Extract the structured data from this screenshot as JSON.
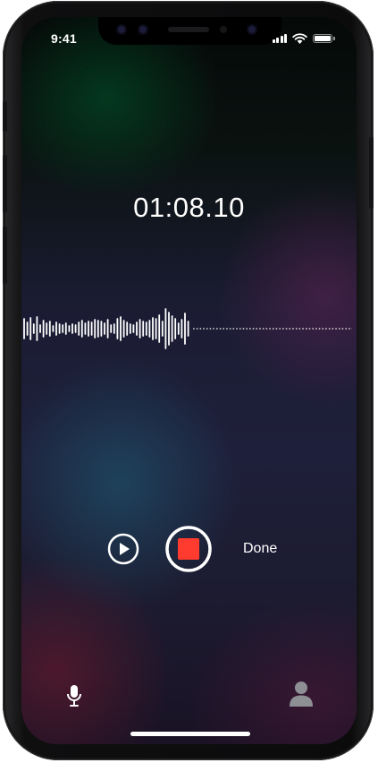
{
  "status_bar": {
    "time": "9:41"
  },
  "recorder": {
    "elapsed_time": "01:08.10",
    "done_label": "Done",
    "record_color": "#ff3b30"
  },
  "icons": {
    "play": "play-icon",
    "stop": "stop-record-icon",
    "microphone": "microphone-icon",
    "profile": "person-icon"
  }
}
